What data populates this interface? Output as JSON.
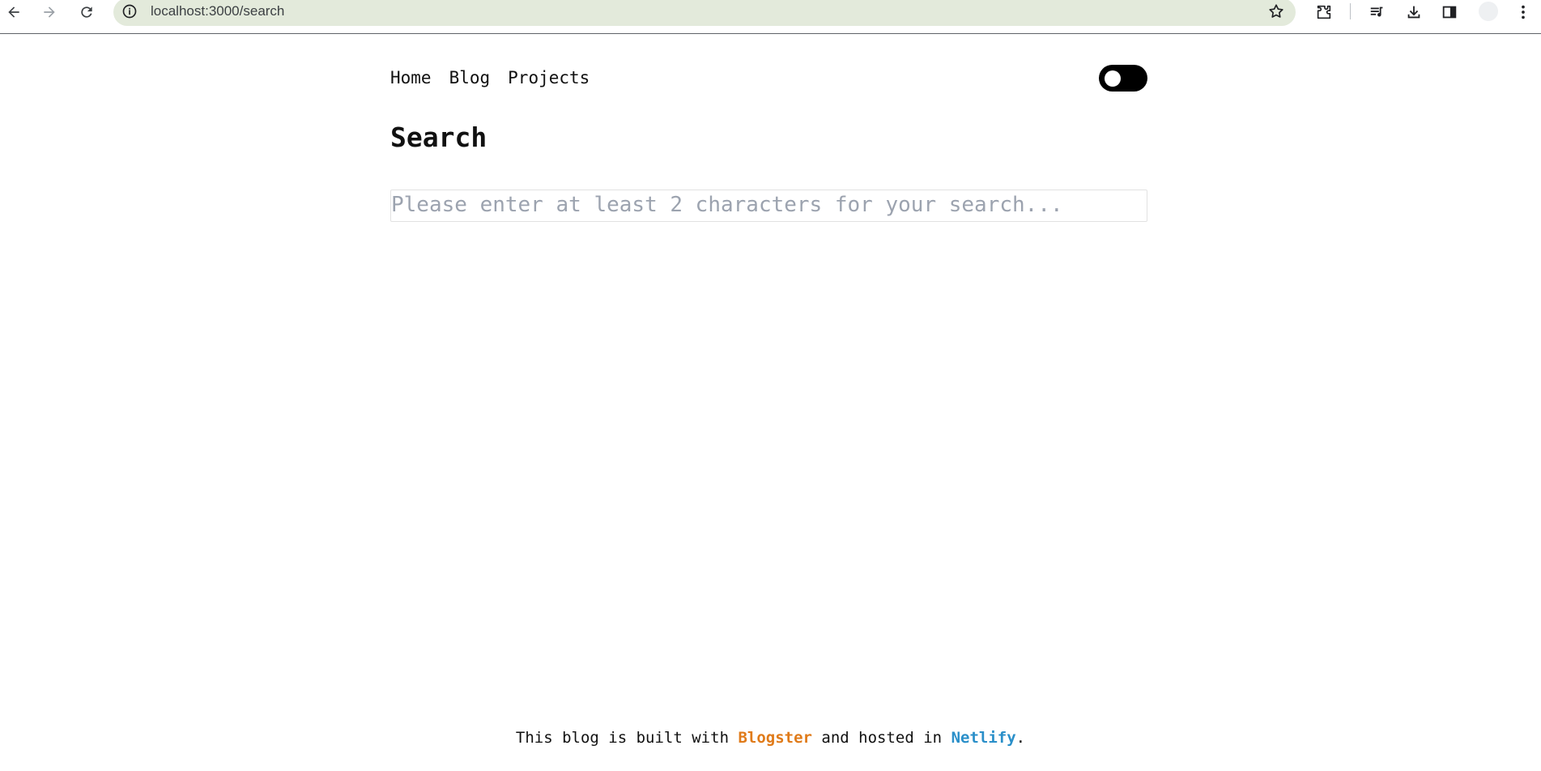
{
  "browser": {
    "url": "localhost:3000/search"
  },
  "nav": {
    "items": [
      {
        "label": "Home"
      },
      {
        "label": "Blog"
      },
      {
        "label": "Projects"
      }
    ]
  },
  "page": {
    "title": "Search"
  },
  "search": {
    "placeholder": "Please enter at least 2 characters for your search...",
    "value": ""
  },
  "footer": {
    "text_before": "This blog is built with ",
    "link1": "Blogster",
    "text_middle": " and hosted in ",
    "link2": "Netlify",
    "text_after": "."
  },
  "colors": {
    "omnibox_bg": "#e3eadb",
    "toggle_bg": "#000000",
    "blogster_link": "#e07b1a",
    "netlify_link": "#2a8fc9",
    "placeholder": "#9ca3af"
  },
  "icons": [
    "back-arrow-icon",
    "forward-arrow-icon",
    "reload-icon",
    "site-info-icon",
    "bookmark-star-icon",
    "extensions-icon",
    "reading-list-icon",
    "download-icon",
    "side-panel-icon",
    "kebab-menu-icon"
  ]
}
